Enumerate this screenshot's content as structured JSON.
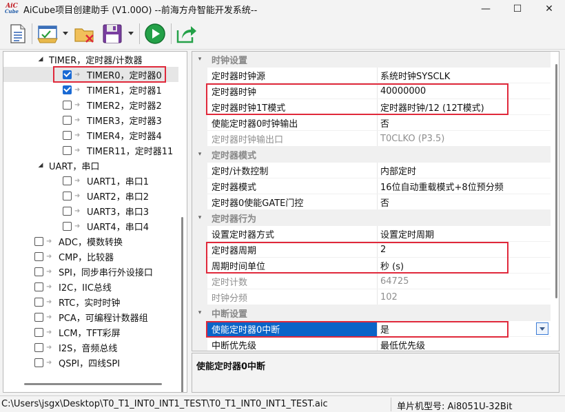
{
  "window": {
    "title": "AiCube项目创建助手 (V1.00O) --前海方舟智能开发系统--",
    "logo_top": "AiC",
    "logo_bottom": "Cube",
    "controls": {
      "minimize": "—",
      "maximize": "☐",
      "close": "✕"
    }
  },
  "toolbar": {
    "buttons": [
      "new-file-icon",
      "open-project-icon",
      "close-project-icon",
      "save-icon",
      "run-icon",
      "export-icon"
    ]
  },
  "tree": {
    "items": [
      {
        "label": "TIMER，定时器/计数器",
        "level": 1,
        "group": true
      },
      {
        "label": "TIMER0，定时器0",
        "level": 2,
        "checked": true,
        "selected": true
      },
      {
        "label": "TIMER1，定时器1",
        "level": 2,
        "checked": true
      },
      {
        "label": "TIMER2，定时器2",
        "level": 2,
        "checked": false
      },
      {
        "label": "TIMER3，定时器3",
        "level": 2,
        "checked": false
      },
      {
        "label": "TIMER4，定时器4",
        "level": 2,
        "checked": false
      },
      {
        "label": "TIMER11，定时器11",
        "level": 2,
        "checked": false
      },
      {
        "label": "UART，串口",
        "level": 1,
        "group": true
      },
      {
        "label": "UART1，串口1",
        "level": 2,
        "checked": false
      },
      {
        "label": "UART2，串口2",
        "level": 2,
        "checked": false
      },
      {
        "label": "UART3，串口3",
        "level": 2,
        "checked": false
      },
      {
        "label": "UART4，串口4",
        "level": 2,
        "checked": false
      },
      {
        "label": "ADC，模数转换",
        "level": 0,
        "checked": false
      },
      {
        "label": "CMP，比较器",
        "level": 0,
        "checked": false
      },
      {
        "label": "SPI，同步串行外设接口",
        "level": 0,
        "checked": false
      },
      {
        "label": "I2C，IIC总线",
        "level": 0,
        "checked": false
      },
      {
        "label": "RTC，实时时钟",
        "level": 0,
        "checked": false
      },
      {
        "label": "PCA，可编程计数器组",
        "level": 0,
        "checked": false
      },
      {
        "label": "LCM，TFT彩屏",
        "level": 0,
        "checked": false
      },
      {
        "label": "I2S，音频总线",
        "level": 0,
        "checked": false
      },
      {
        "label": "QSPI，四线SPI",
        "level": 0,
        "checked": false
      }
    ]
  },
  "properties": {
    "rows": [
      {
        "type": "category",
        "name": "时钟设置"
      },
      {
        "name": "定时器时钟源",
        "value": "系统时钟SYSCLK"
      },
      {
        "name": "定时器时钟",
        "value": "40000000"
      },
      {
        "name": "定时器时钟1T模式",
        "value": "定时器时钟/12 (12T模式)"
      },
      {
        "name": "使能定时器0时钟输出",
        "value": "否"
      },
      {
        "name": "定时器时钟输出口",
        "value": "T0CLKO (P3.5)",
        "disabled": true
      },
      {
        "type": "category",
        "name": "定时器模式"
      },
      {
        "name": "定时/计数控制",
        "value": "内部定时"
      },
      {
        "name": "定时器模式",
        "value": "16位自动重载模式+8位预分频"
      },
      {
        "name": "定时器0使能GATE门控",
        "value": "否"
      },
      {
        "type": "category",
        "name": "定时器行为"
      },
      {
        "name": "设置定时器方式",
        "value": "设置定时周期"
      },
      {
        "name": "定时器周期",
        "value": "2"
      },
      {
        "name": "周期时间单位",
        "value": "秒 (s)"
      },
      {
        "name": "定时计数",
        "value": "64725",
        "disabled": true
      },
      {
        "name": "时钟分频",
        "value": "102",
        "disabled": true
      },
      {
        "type": "category",
        "name": "中断设置"
      },
      {
        "name": "使能定时器0中断",
        "value": "是",
        "selected": true
      },
      {
        "name": "中断优先级",
        "value": "最低优先级"
      }
    ]
  },
  "description": {
    "title": "使能定时器0中断"
  },
  "status": {
    "path": "C:\\Users\\jsgx\\Desktop\\T0_T1_INT0_INT1_TEST\\T0_T1_INT0_INT1_TEST.aic",
    "chip": "单片机型号:   Ai8051U-32Bit"
  }
}
